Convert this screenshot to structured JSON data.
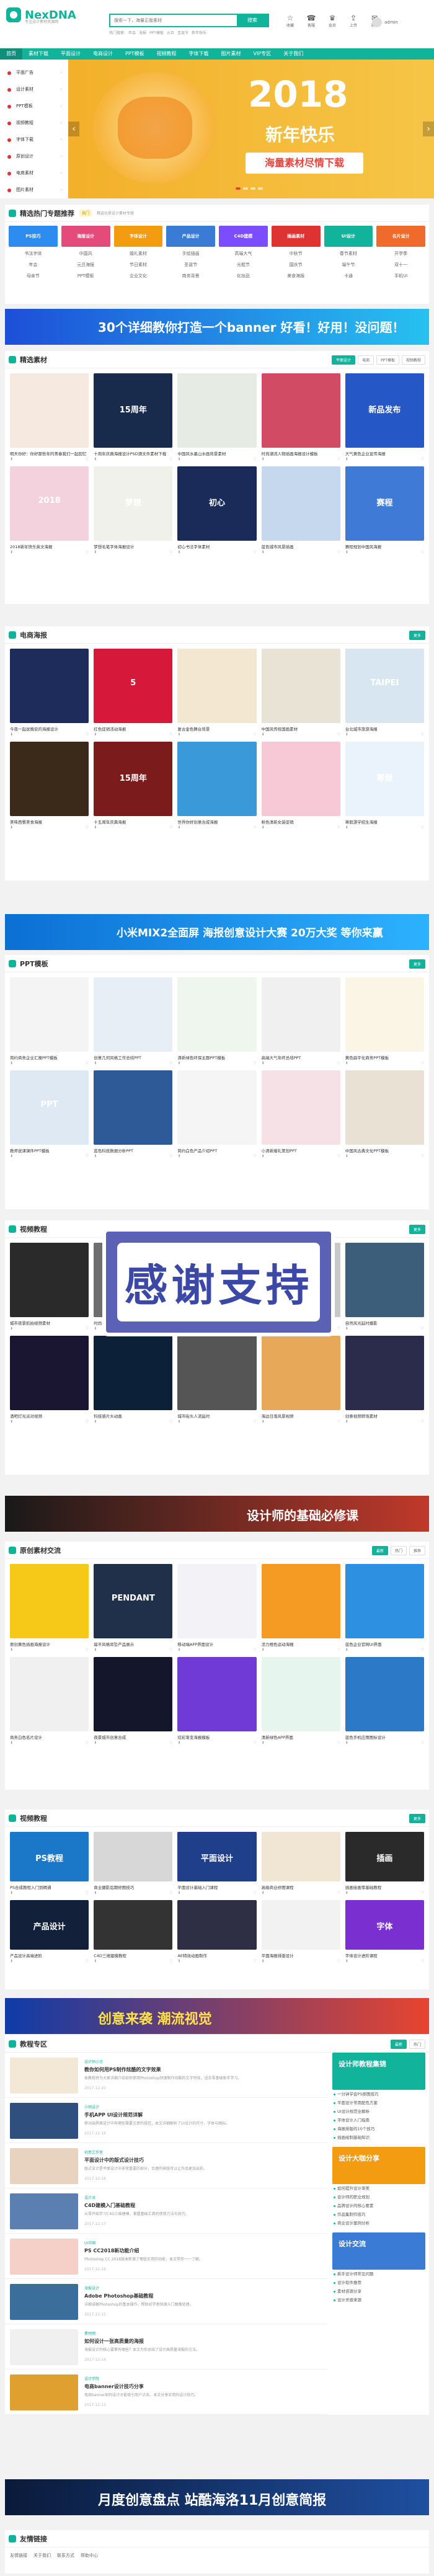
{
  "header": {
    "logo": "NexDNA",
    "logo_sub": "专注设计素材资源网",
    "search_placeholder": "搜索一下，海量正版素材",
    "search_button": "搜索",
    "hotwords": [
      "热门搜索:",
      "年会",
      "海报",
      "PPT模板",
      "元旦",
      "圣诞节",
      "新年快乐"
    ],
    "icons": [
      {
        "label": "收藏",
        "glyph": "☆"
      },
      {
        "label": "客服",
        "glyph": "☎"
      },
      {
        "label": "会员",
        "glyph": "♛"
      },
      {
        "label": "上传",
        "glyph": "⇪"
      },
      {
        "label": "消息",
        "glyph": "✉"
      }
    ],
    "user": "admin"
  },
  "nav": [
    "首页",
    "素材下载",
    "平面设计",
    "电商设计",
    "PPT模板",
    "视频教程",
    "字体下载",
    "图片素材",
    "VIP专区",
    "关于我们"
  ],
  "hero": {
    "sidebar": [
      "平面广告",
      "设计素材",
      "PPT模板",
      "视频教程",
      "字体下载",
      "原创设计",
      "电商素材",
      "图片素材"
    ],
    "year": "2018",
    "greeting": "新年快乐",
    "cta": "海量素材尽情下载"
  },
  "sections": {
    "hot": {
      "title": "精选热门专题推荐",
      "tag": "热门",
      "note": "精选优质设计素材专题",
      "tags": [
        "PS技巧",
        "海报设计",
        "字体设计",
        "产品设计",
        "C4D建模",
        "插画素材",
        "UI设计",
        "名片设计"
      ],
      "texts": [
        "书法字体",
        "中国风",
        "婚礼素材",
        "手绘插画",
        "高端大气",
        "中秋节",
        "春节素材",
        "开学季",
        "年会",
        "元旦海报",
        "节日素材",
        "圣诞节",
        "光棍节",
        "国庆节",
        "端午节",
        "双十一",
        "母亲节",
        "PPT模板",
        "企业文化",
        "商务背景",
        "化妆品",
        "美食海报",
        "卡通",
        "手机UI"
      ]
    },
    "banner1": "30个详细教你打造一个banner 好看！好用！没问题！",
    "featured": {
      "title": "精选素材",
      "tabs": [
        "平面设计",
        "电商",
        "PPT模板",
        "视频教程"
      ]
    },
    "ecommerce": {
      "title": "电商海报",
      "tabs": [
        "更多"
      ]
    },
    "banner2": "小米MIX2全面屏 海报创意设计大赛 20万大奖 等你来赢",
    "ppt": {
      "title": "PPT模板",
      "tabs": [
        "更多"
      ]
    },
    "video": {
      "title": "视频教程",
      "tabs": [
        "更多"
      ]
    },
    "banner3": "设计师的基础必修课",
    "original": {
      "title": "原创素材交流",
      "tabs": [
        "最新",
        "热门",
        "推荐"
      ]
    },
    "course": {
      "title": "视频教程",
      "tabs": [
        "更多"
      ]
    },
    "banner4": "创意来袭 潮流视觉",
    "tutorial": {
      "title": "教程专区",
      "tabs": [
        "最新",
        "热门"
      ]
    },
    "banner5": "月度创意盘点 站酷海洛11月创意简报",
    "footer_title": "友情链接"
  },
  "thanks": "感谢支持",
  "featured_cards": [
    {
      "cap": "明天你好：你好那些年的青春我们一起回忆",
      "bg": "#f5e9e0",
      "label": ""
    },
    {
      "cap": "十周年庆典海报设计PSD源文件素材下载",
      "bg": "#182b4d",
      "label": "15周年"
    },
    {
      "cap": "中国风水墨山水画背景素材",
      "bg": "#e6ece4",
      "label": ""
    },
    {
      "cap": "时尚潮流人物插画海报设计模板",
      "bg": "#d24b64",
      "label": ""
    },
    {
      "cap": "大气黄色企业宣传海报",
      "bg": "#2557c7",
      "label": "新品发布"
    },
    {
      "cap": "2018新年快乐英文海报",
      "bg": "#f4d2dd",
      "label": "2018"
    },
    {
      "cap": "梦想毛笔字体海报设计",
      "bg": "#f1f1ec",
      "label": "梦想"
    },
    {
      "cap": "初心书法字体素材",
      "bg": "#1a2b5a",
      "label": "初心"
    },
    {
      "cap": "蓝色城市风景插画",
      "bg": "#c6d8ee",
      "label": ""
    },
    {
      "cap": "赛程规划中国风海报",
      "bg": "#3f7bd6",
      "label": "赛程"
    }
  ],
  "ecom_cards": [
    {
      "cap": "今夜一起说晚安的海报设计",
      "bg": "#1d2c5a",
      "label": ""
    },
    {
      "cap": "红色促销活动海报",
      "bg": "#d6183a",
      "label": "5"
    },
    {
      "cap": "复古金色舞台背景",
      "bg": "#f3e7d2",
      "label": ""
    },
    {
      "cap": "中国风传统国画素材",
      "bg": "#e9e3d6",
      "label": ""
    },
    {
      "cap": "台北城市旅游海报",
      "bg": "#d8e6f2",
      "label": "TAIPEI"
    },
    {
      "cap": "美味西餐美食海报",
      "bg": "#3b2a1a",
      "label": ""
    },
    {
      "cap": "十五周年庆典海报",
      "bg": "#7c1b1b",
      "label": "15周年"
    },
    {
      "cap": "世界你好创意合成海报",
      "bg": "#3a9ad9",
      "label": ""
    },
    {
      "cap": "粉色清新女装促销",
      "bg": "#f7c9d6",
      "label": ""
    },
    {
      "cap": "寒假游学招生海报",
      "bg": "#eaf3fb",
      "label": "寒假"
    }
  ],
  "ppt_cards": [
    {
      "cap": "简约商务企业汇报PPT模板",
      "bg": "#f4f4f4",
      "label": ""
    },
    {
      "cap": "创意几何风格工作总结PPT",
      "bg": "#e8eef5",
      "label": ""
    },
    {
      "cap": "清新绿色环保主题PPT模板",
      "bg": "#eef6ee",
      "label": ""
    },
    {
      "cap": "高端大气年终总结PPT",
      "bg": "#f0f0f0",
      "label": ""
    },
    {
      "cap": "黄色扁平化商务PPT模板",
      "bg": "#fbf5e6",
      "label": ""
    },
    {
      "cap": "教师说课课件PPT模板",
      "bg": "#dfe9f3",
      "label": "PPT"
    },
    {
      "cap": "蓝色科技数据分析PPT",
      "bg": "#2f5a98",
      "label": ""
    },
    {
      "cap": "简约白色产品介绍PPT",
      "bg": "#f5f5f5",
      "label": ""
    },
    {
      "cap": "小清新婚礼策划PPT",
      "bg": "#f6e1e6",
      "label": ""
    },
    {
      "cap": "中国风古典文化PPT模板",
      "bg": "#e9e1d4",
      "label": ""
    }
  ],
  "video_cards": [
    {
      "cap": "城市夜景航拍视频素材",
      "bg": "#2a2a2a",
      "label": ""
    },
    {
      "cap": "时尚模特拍摄花絮",
      "bg": "#6e6e6e",
      "label": ""
    },
    {
      "cap": "创意光效粒子视频",
      "bg": "#101820",
      "label": ""
    },
    {
      "cap": "企业宣传片头模板",
      "bg": "#c9c9c9",
      "label": ""
    },
    {
      "cap": "自然风光延时摄影",
      "bg": "#3d5e7a",
      "label": ""
    },
    {
      "cap": "酒吧灯光派对视频",
      "bg": "#1a1530",
      "label": ""
    },
    {
      "cap": "科技感片头动画",
      "bg": "#0c2038",
      "label": ""
    },
    {
      "cap": "城市街头人流延时",
      "bg": "#555",
      "label": ""
    },
    {
      "cap": "海边日落风景视频",
      "bg": "#e8a85a",
      "label": ""
    },
    {
      "cap": "创意视频转场素材",
      "bg": "#2b2b4b",
      "label": ""
    }
  ],
  "orig_cards": [
    {
      "cap": "原创黄色插画海报设计",
      "bg": "#f6c919",
      "label": ""
    },
    {
      "cap": "扁平风格吊坠产品展示",
      "bg": "#21304a",
      "label": "PENDANT"
    },
    {
      "cap": "移动端APP界面设计",
      "bg": "#f2f2f7",
      "label": ""
    },
    {
      "cap": "活力橙色运动海报",
      "bg": "#f59a23",
      "label": ""
    },
    {
      "cap": "蓝色企业官网UI界面",
      "bg": "#2d90e0",
      "label": ""
    },
    {
      "cap": "商务白色名片设计",
      "bg": "#f0f0f0",
      "label": ""
    },
    {
      "cap": "夜景城市创意合成",
      "bg": "#14172c",
      "label": ""
    },
    {
      "cap": "炫彩渐变海报模板",
      "bg": "#6f3ad6",
      "label": ""
    },
    {
      "cap": "清新绿色APP界面",
      "bg": "#e6f6ef",
      "label": ""
    },
    {
      "cap": "蓝色手机应用图标设计",
      "bg": "#2c79c8",
      "label": ""
    }
  ],
  "course_cards": [
    {
      "cap": "PS合成教程入门到精通",
      "bg": "#1b77c8",
      "label": "PS教程"
    },
    {
      "cap": "商业摄影后期修图技巧",
      "bg": "#d7d7d7",
      "label": ""
    },
    {
      "cap": "平面设计基础入门课程",
      "bg": "#1f3f8a",
      "label": "平面设计"
    },
    {
      "cap": "高级商业修图课程",
      "bg": "#f1e5d3",
      "label": ""
    },
    {
      "cap": "插画绘画零基础教程",
      "bg": "#2a2a2a",
      "label": "插画"
    },
    {
      "cap": "产品设计高端进阶",
      "bg": "#12203a",
      "label": "产品设计"
    },
    {
      "cap": "C4D三维建模教程",
      "bg": "#333",
      "label": ""
    },
    {
      "cap": "AE特效动画制作",
      "bg": "#2e2e44",
      "label": ""
    },
    {
      "cap": "平面海报排版设计",
      "bg": "#f2f2f2",
      "label": ""
    },
    {
      "cap": "字体设计进阶课程",
      "bg": "#7a2fd0",
      "label": "字体"
    }
  ],
  "tutorials": [
    {
      "author": "设计师小王",
      "title": "教你如何用PS制作炫酷的文字效果",
      "desc": "本教程将为大家详细介绍如何使用Photoshop快速制作炫酷的文字特效，适合零基础新手学习。",
      "time": "2017-12-20",
      "bg": "#f3e8d6"
    },
    {
      "author": "小明设计",
      "title": "手机APP UI设计规范详解",
      "desc": "移动端界面设计中有哪些需要注意的规范，本文详细解析了UI设计的尺寸、字体与图标。",
      "time": "2017-12-19",
      "bg": "#2f4f7f"
    },
    {
      "author": "创意工作室",
      "title": "平面设计中的版式设计技巧",
      "desc": "版式设计是平面设计中非常重要的部分，合理的排版可以让作品更加出彩。",
      "time": "2017-12-18",
      "bg": "#e8d3c0"
    },
    {
      "author": "设计派",
      "title": "C4D建模入门基础教程",
      "desc": "从零开始学习C4D三维建模，掌握基础工具的使用方法与技巧。",
      "time": "2017-12-17",
      "bg": "#5a7fb0"
    },
    {
      "author": "UI中国",
      "title": "PS CC2018新功能介绍",
      "desc": "Photoshop CC 2018版本新增了哪些实用的功能，本文带你一一了解。",
      "time": "2017-12-16",
      "bg": "#f4d0c9"
    },
    {
      "author": "海报设计",
      "title": "Adobe Photoshop基础教程",
      "desc": "详细讲解Photoshop的基本操作，帮助初学者快速入门图像处理。",
      "time": "2017-12-15",
      "bg": "#3c6e9c"
    },
    {
      "author": "素材网",
      "title": "如何设计一张高质量的海报",
      "desc": "海报设计的核心要素有哪些？本文为你总结了设计高质量海报的方法。",
      "time": "2017-12-14",
      "bg": "#f0f0f0"
    },
    {
      "author": "设计学院",
      "title": "电商banner设计技巧分享",
      "desc": "电商banner如何设计才能吸引用户点击，本文分享实用的设计技巧。",
      "time": "2017-12-13",
      "bg": "#e0a030"
    }
  ],
  "tut_side": [
    {
      "banner": "设计师教程集锦",
      "bg": "#12b39b",
      "links": [
        "一分钟学会PS抠图技巧",
        "平面设计常用配色方案",
        "UI设计规范全解析",
        "字体设计入门指南",
        "海报排版的10个技巧",
        "插画绘制基础知识"
      ]
    },
    {
      "banner": "设计大咖分享",
      "bg": "#f39c12",
      "links": [
        "如何提升设计审美",
        "设计师的职业规划",
        "品牌设计的核心要素",
        "作品集制作技巧",
        "商业设计案例分析"
      ]
    },
    {
      "banner": "设计交流",
      "bg": "#3a7bd5",
      "links": [
        "新手设计师常见问题",
        "设计软件推荐",
        "素材资源分享",
        "设计灵感来源"
      ]
    }
  ],
  "footer_links": [
    "友情链接",
    "关于我们",
    "联系方式",
    "帮助中心"
  ]
}
